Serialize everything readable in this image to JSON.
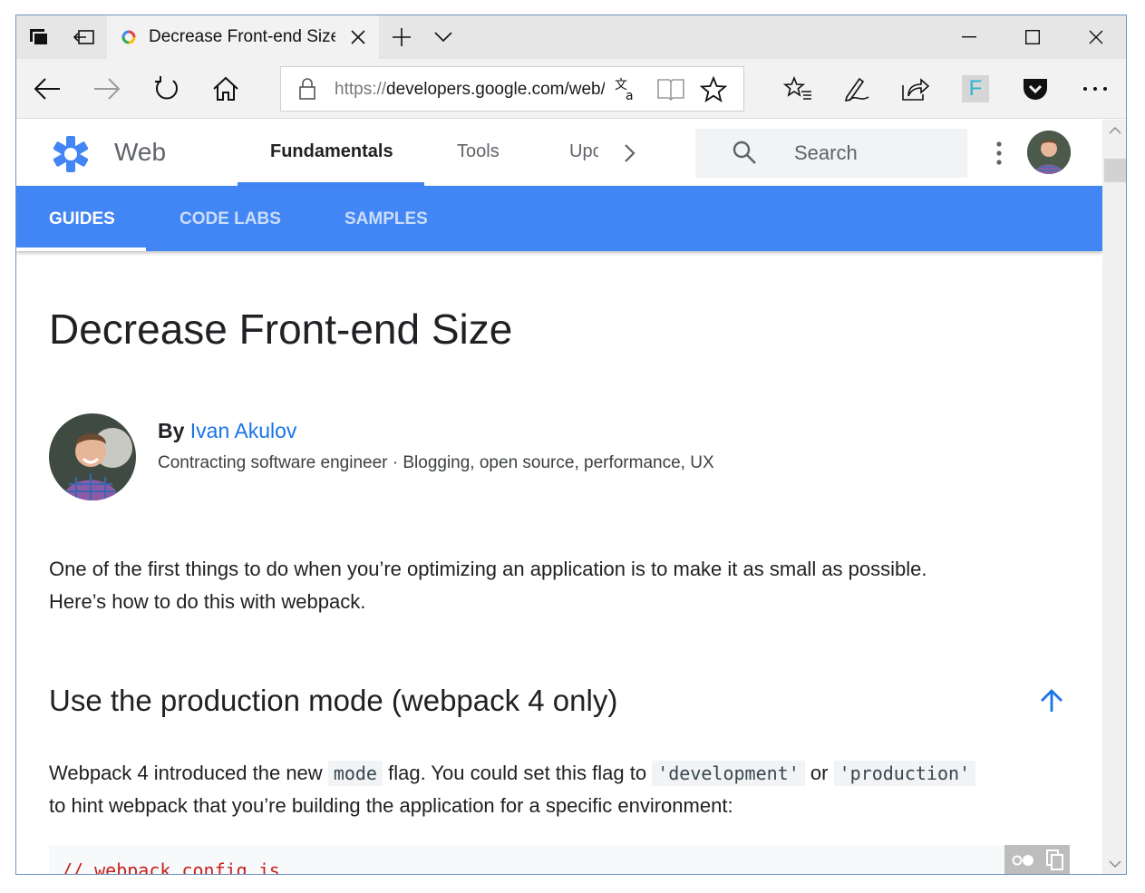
{
  "browser": {
    "tab_title": "Decrease Front-end Size",
    "url_scheme": "https://",
    "url_host": "developers.google.com/web/fundamentals/performance/webpack/decrease-frontend-size"
  },
  "site": {
    "name": "Web",
    "tabs": [
      "Fundamentals",
      "Tools",
      "Upc"
    ],
    "search_placeholder": "Search",
    "subtabs": [
      "GUIDES",
      "CODE LABS",
      "SAMPLES"
    ]
  },
  "article": {
    "title": "Decrease Front-end Size",
    "by_label": "By",
    "author_name": "Ivan Akulov",
    "author_desc": "Contracting software engineer · Blogging, open source, performance, UX",
    "intro_line1": "One of the first things to do when you’re optimizing an application is to make it as small as possible.",
    "intro_line2": "Here’s how to do this with webpack.",
    "section_title": "Use the production mode (webpack 4 only)",
    "p2_a": "Webpack 4 introduced the new",
    "p2_code1": "mode",
    "p2_b": "flag. You could set this flag to",
    "p2_code2": "'development'",
    "p2_c": "or",
    "p2_code3": "'production'",
    "p2_line2": "to hint webpack that you’re building the application for a specific environment:",
    "code_comment": "// webpack.config.js"
  },
  "colors": {
    "accent": "#4285f4",
    "link": "#1a73e8"
  }
}
